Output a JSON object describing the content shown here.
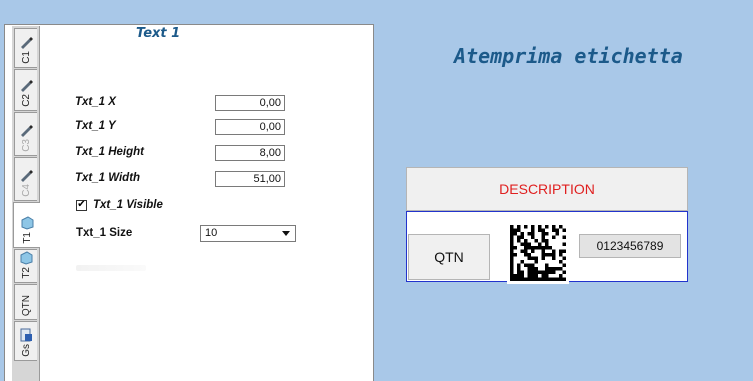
{
  "tabs": [
    {
      "label": "C1",
      "icon": "pen-icon",
      "active": false,
      "disabled": false
    },
    {
      "label": "C2",
      "icon": "pen-icon",
      "active": false,
      "disabled": false
    },
    {
      "label": "C3",
      "icon": "pen-icon",
      "active": false,
      "disabled": true
    },
    {
      "label": "C4",
      "icon": "pen-icon",
      "active": false,
      "disabled": true
    },
    {
      "label": "T1",
      "icon": "text-box-icon",
      "active": true,
      "disabled": false
    },
    {
      "label": "T2",
      "icon": "text-box-icon",
      "active": false,
      "disabled": false
    },
    {
      "label": "QTN",
      "icon": "",
      "active": false,
      "disabled": false
    },
    {
      "label": "Gs",
      "icon": "settings-doc-icon",
      "active": false,
      "disabled": false
    }
  ],
  "form": {
    "title": "Text 1",
    "fields": [
      {
        "label": "Txt_1 X",
        "value": "0,00"
      },
      {
        "label": "Txt_1 Y",
        "value": "0,00"
      },
      {
        "label": "Txt_1 Height",
        "value": "8,00"
      },
      {
        "label": "Txt_1 Width",
        "value": "51,00"
      }
    ],
    "visible": {
      "label": "Txt_1 Visible",
      "checked": true,
      "mark": "✔"
    },
    "size": {
      "label": "Txt_1 Size",
      "value": "10"
    }
  },
  "preview": {
    "title": "Atemprima etichetta",
    "description": "DESCRIPTION",
    "qtn": "QTN",
    "code": "0123456789"
  },
  "colors": {
    "background": "#a9c8e8",
    "title_blue": "#1c5a8a",
    "description_red": "#e02020",
    "frame_blue": "#2233cc"
  }
}
